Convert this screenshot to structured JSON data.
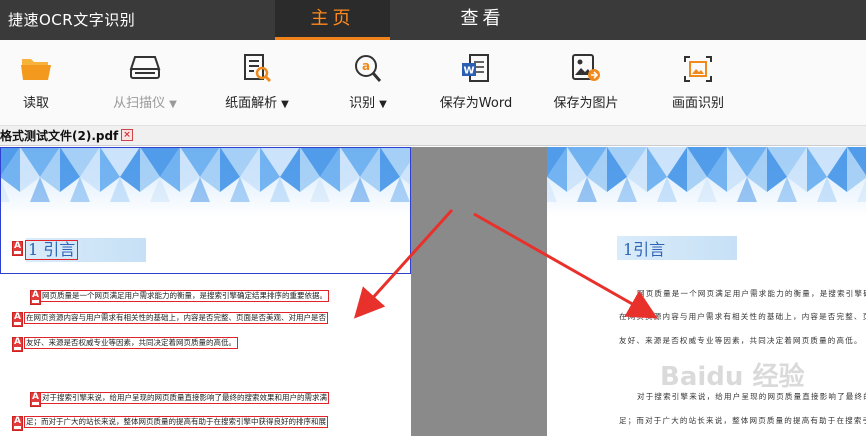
{
  "app": {
    "title": "捷速OCR文字识别"
  },
  "tabs": [
    {
      "label": "主页",
      "active": true
    },
    {
      "label": "查看",
      "active": false
    }
  ],
  "toolbar": {
    "open": "读取",
    "scanner": "从扫描仪",
    "page_analysis": "纸面解析",
    "recognize": "识别",
    "save_word": "保存为Word",
    "save_image": "保存为图片",
    "screen_ocr": "画面识别",
    "scanner_disabled": true
  },
  "document": {
    "tab_name": "格式测试文件(2).pdf",
    "close_icon": "close-icon"
  },
  "left_page": {
    "heading": "1 引言",
    "ocr_tag": "A",
    "lines": [
      "网页质量是一个网页满足用户需求能力的衡量，是搜索引擎确定结果排序的重要依据。",
      "在网页资源内容与用户需求有相关性的基础上，内容是否完整、页面是否美观、对用户是否",
      "友好、来源是否权威专业等因素，共同决定着网页质量的高低。",
      "对于搜索引擎来说，给用户呈现的网页质量直接影响了最终的搜索效果和用户的需求满",
      "足；而对于广大的站长来说，整体网页质量的提高有助于在搜索引擎中获得良好的排序和展"
    ]
  },
  "right_page": {
    "heading": "1引言",
    "lines": [
      "网页质量是一个网页满足用户需求能力的衡量，是搜索引擎确定",
      "在网页资源内容与用户需求有相关性的基础上，内容是否完整、页面",
      "友好、来源是否权威专业等因素，共同决定着网页质量的高低。",
      "对于搜索引擎来说，给用户呈现的网页质量直接影响了最终的",
      "足；而对于广大的站长来说，整体网页质量的提高有助于在搜索引擎"
    ]
  },
  "watermark": "Baidu 经验",
  "colors": {
    "titlebar": "#3a3a3a",
    "active_tab": "#ff8a1e",
    "ocr_box": "#e0242a",
    "selection": "#2f3fcf",
    "arrow": "#e8312b",
    "gutter": "#8a8a8a"
  }
}
